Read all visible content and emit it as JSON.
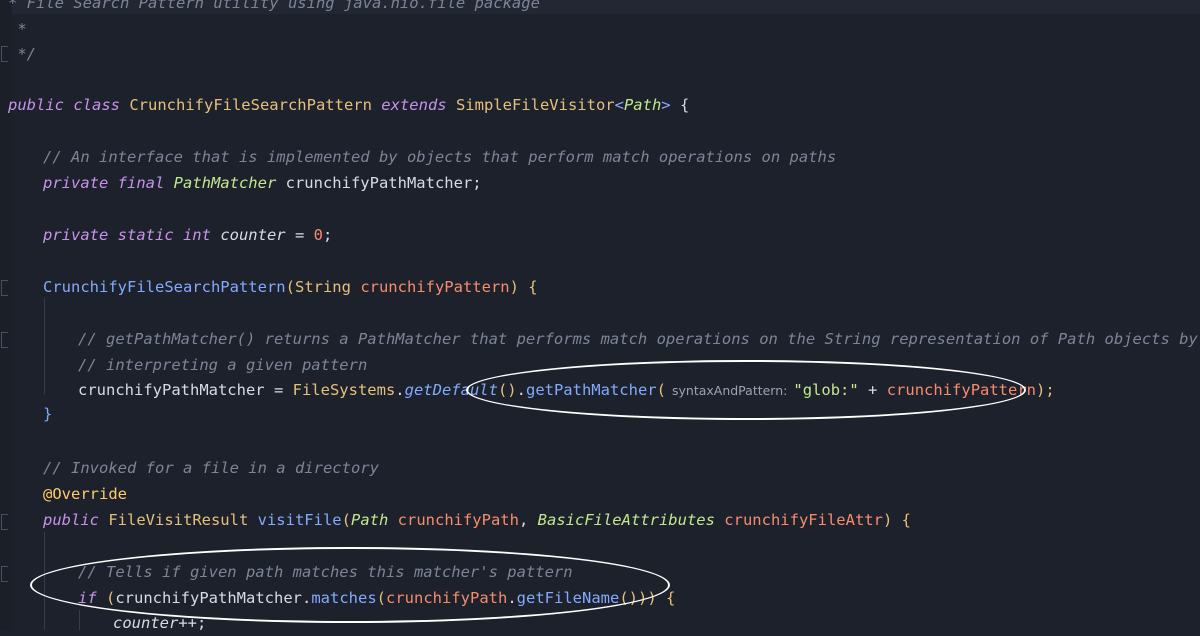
{
  "code": {
    "l_header": "* File Search Pattern utility using java.nio.file package",
    "l_star": " *",
    "l_end": " */",
    "class_kw": "public class ",
    "class_name": "CrunchifyFileSearchPattern",
    "extends_kw": " extends ",
    "super_name": "SimpleFileVisitor",
    "gen_open": "<",
    "gen_type": "Path",
    "gen_close": ">",
    "brace_open": " {",
    "c_interface": "// An interface that is implemented by objects that perform match operations on paths",
    "pf_kw": "private final ",
    "matcher_type": "PathMatcher",
    "matcher_field": " crunchifyPathMatcher;",
    "pst_kw": "private static int ",
    "counter_var": "counter",
    "eq": " = ",
    "zero": "0",
    "semi": ";",
    "ctor_name": "CrunchifyFileSearchPattern",
    "ctor_open": "(",
    "string_type": "String ",
    "ctor_param": "crunchifyPattern",
    "ctor_close": ") {",
    "c_getmatcher1": "// getPathMatcher() returns a PathMatcher that performs match operations on the String representation of Path objects by",
    "c_getmatcher2": "// interpreting a given pattern",
    "assign_lhs": "crunchifyPathMatcher = ",
    "filesystems": "FileSystems",
    "dot1": ".",
    "get_default": "getDefault",
    "call_parens": "()",
    "dot2": ".",
    "get_path_matcher": "getPathMatcher",
    "open_paren": "(",
    "param_hint": "syntaxAndPattern:",
    "glob_str": "\"glob:\"",
    "plus": " + ",
    "pattern_arg": "crunchifyPattern",
    "close_stmt": ");",
    "brace_close": "}",
    "c_invoked": "// Invoked for a file in a directory",
    "override": "@Override",
    "pub_kw": "public ",
    "fvr_type": "FileVisitResult ",
    "visit_file": "visitFile",
    "vf_open": "(",
    "path_type": "Path ",
    "path_param": "crunchifyPath",
    "comma": ", ",
    "bfa_type": "BasicFileAttributes ",
    "attr_param": "crunchifyFileAttr",
    "vf_close": ") {",
    "c_tells": "// Tells if given path matches this matcher's pattern",
    "if_kw": "if ",
    "if_open": "(",
    "matcher_ref": "crunchifyPathMatcher",
    "dot3": ".",
    "matches": "matches",
    "m_open": "(",
    "path_ref": "crunchifyPath",
    "dot4": ".",
    "get_file_name": "getFileName",
    "if_close": "())) {",
    "counter_inc": "counter",
    "inc_op": "++;"
  },
  "colors": {
    "background": "#1d212b",
    "keyword": "#c792ea",
    "comment": "#7c8597",
    "class": "#e5c07b",
    "method": "#82aaff",
    "parameter": "#f78c6c",
    "string": "#c3e88d",
    "highlight_ellipse": "#ffffff"
  }
}
